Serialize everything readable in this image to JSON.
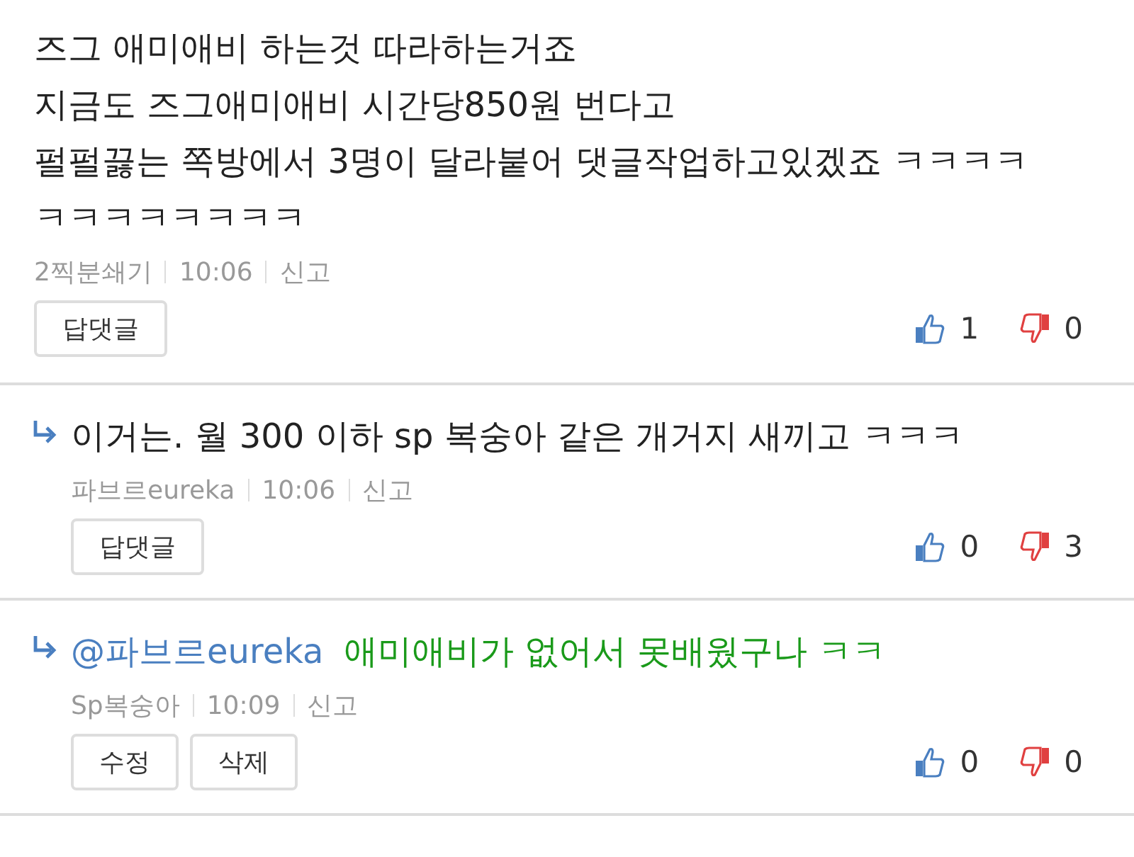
{
  "comments": [
    {
      "reply": false,
      "lines": [
        "즈그 애미애비 하는것 따라하는거죠",
        "지금도 즈그애미애비 시간당850원 번다고",
        "펄펄끓는 쪽방에서 3명이 달라붙어 댓글작업하고있겠죠 ㅋㅋㅋㅋ",
        "ㅋㅋㅋㅋㅋㅋㅋㅋ"
      ],
      "author": "2찍분쇄기",
      "time": "10:06",
      "report": "신고",
      "buttons": [
        "답댓글"
      ],
      "likes": "1",
      "dislikes": "0"
    },
    {
      "reply": true,
      "lines": [
        "이거는. 월 300 이하 sp 복숭아 같은 개거지 새끼고 ㅋㅋㅋ"
      ],
      "author": "파브르eureka",
      "time": "10:06",
      "report": "신고",
      "buttons": [
        "답댓글"
      ],
      "likes": "0",
      "dislikes": "3"
    },
    {
      "reply": true,
      "mention": "@파브르eureka",
      "lines": [
        "애미애비가 없어서 못배웠구나 ㅋㅋ"
      ],
      "author": "Sp복숭아",
      "time": "10:09",
      "report": "신고",
      "buttons": [
        "수정",
        "삭제"
      ],
      "likes": "0",
      "dislikes": "0"
    }
  ]
}
